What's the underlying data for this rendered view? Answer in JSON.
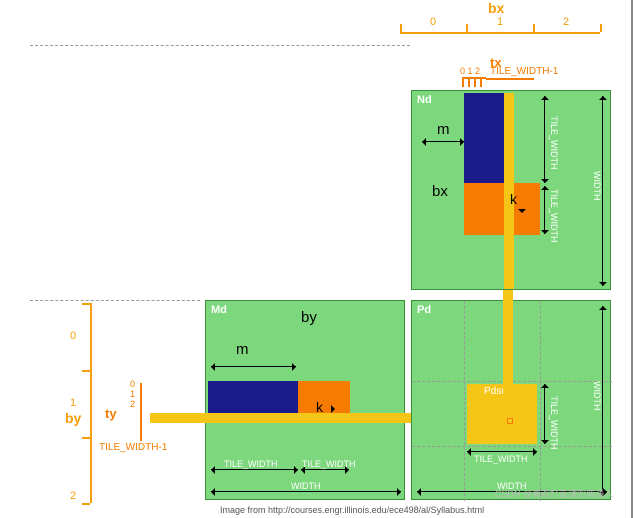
{
  "axes": {
    "bx": {
      "label": "bx",
      "ticks": [
        "0",
        "1",
        "2"
      ]
    },
    "by": {
      "label": "by",
      "ticks": [
        "0",
        "1",
        "2"
      ]
    },
    "tx": {
      "label": "tx",
      "small_ticks": "0 1 2",
      "end": "TILE_WIDTH-1"
    },
    "ty": {
      "label": "ty",
      "small_ticks": [
        "0",
        "1",
        "2"
      ],
      "end": "TILE_WIDTH-1"
    }
  },
  "panels": {
    "nd": {
      "label": "Nd",
      "m": "m",
      "bx": "bx",
      "k": "k",
      "tw1": "TILE_WIDTH",
      "tw2": "TILE_WIDTH",
      "width": "WIDTH"
    },
    "md": {
      "label": "Md",
      "by": "by",
      "m": "m",
      "k": "k",
      "tw1": "TILE_WIDTH",
      "tw2": "TILE_WIDTH",
      "width": "WIDTH"
    },
    "pd": {
      "label": "Pd",
      "sub": "Pdsub",
      "tw": "TILE_WIDTH",
      "width": "WIDTH"
    }
  },
  "credit": "Image from http://courses.engr.illinois.edu/ece498/al/Syllabus.html",
  "watermark": "CSDN @喜欢打篮球的普通人"
}
